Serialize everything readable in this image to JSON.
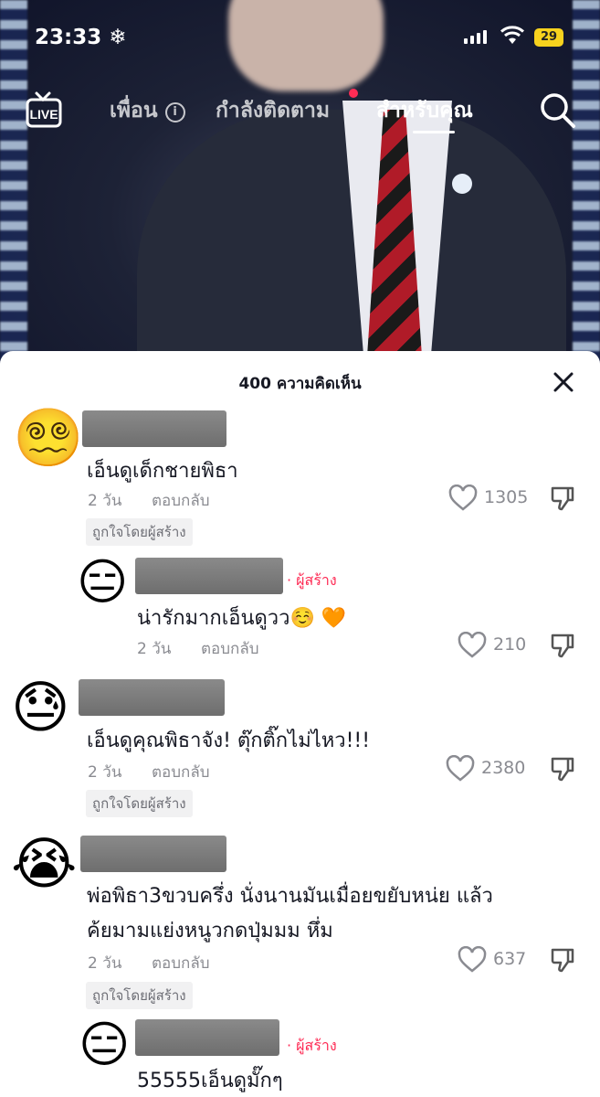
{
  "status": {
    "time": "23:33",
    "battery": "29"
  },
  "nav": {
    "live_label": "LIVE",
    "tabs": [
      {
        "label": "เพื่อน"
      },
      {
        "label": "กำลังติดตาม"
      },
      {
        "label": "สำหรับคุณ"
      }
    ]
  },
  "sheet": {
    "title": "400 ความคิดเห็น"
  },
  "labels": {
    "reply": "ตอบกลับ",
    "liked_by_creator": "ถูกใจโดยผู้สร้าง",
    "creator_tag": "· ผู้สร้าง"
  },
  "comments": [
    {
      "avatar": "😵‍💫",
      "text": "เอ็นดูเด็กชายพิธา",
      "time": "2 วัน",
      "likes": "1305"
    },
    {
      "avatar": "😑",
      "text": "น่ารักมากเอ็นดูวว☺️ 🧡",
      "time": "2 วัน",
      "likes": "210"
    },
    {
      "avatar": "😓",
      "text": "เอ็นดูคุณพิธาจัง! ตุ๊กติ๊กไม่ไหว!!!",
      "time": "2 วัน",
      "likes": "2380"
    },
    {
      "avatar": "😭",
      "text_line1": "พ่อพิธา3ขวบครึ่ง นั่งนานมันเมื่อยขยับหน่ย แล้ว",
      "text_line2": "ค้ยมามแย่งหนูวกดปุ่มมม หึ่ม",
      "time": "2 วัน",
      "likes": "637"
    },
    {
      "avatar": "😑",
      "text": "55555เอ็นดูมั๊กๆ"
    }
  ]
}
